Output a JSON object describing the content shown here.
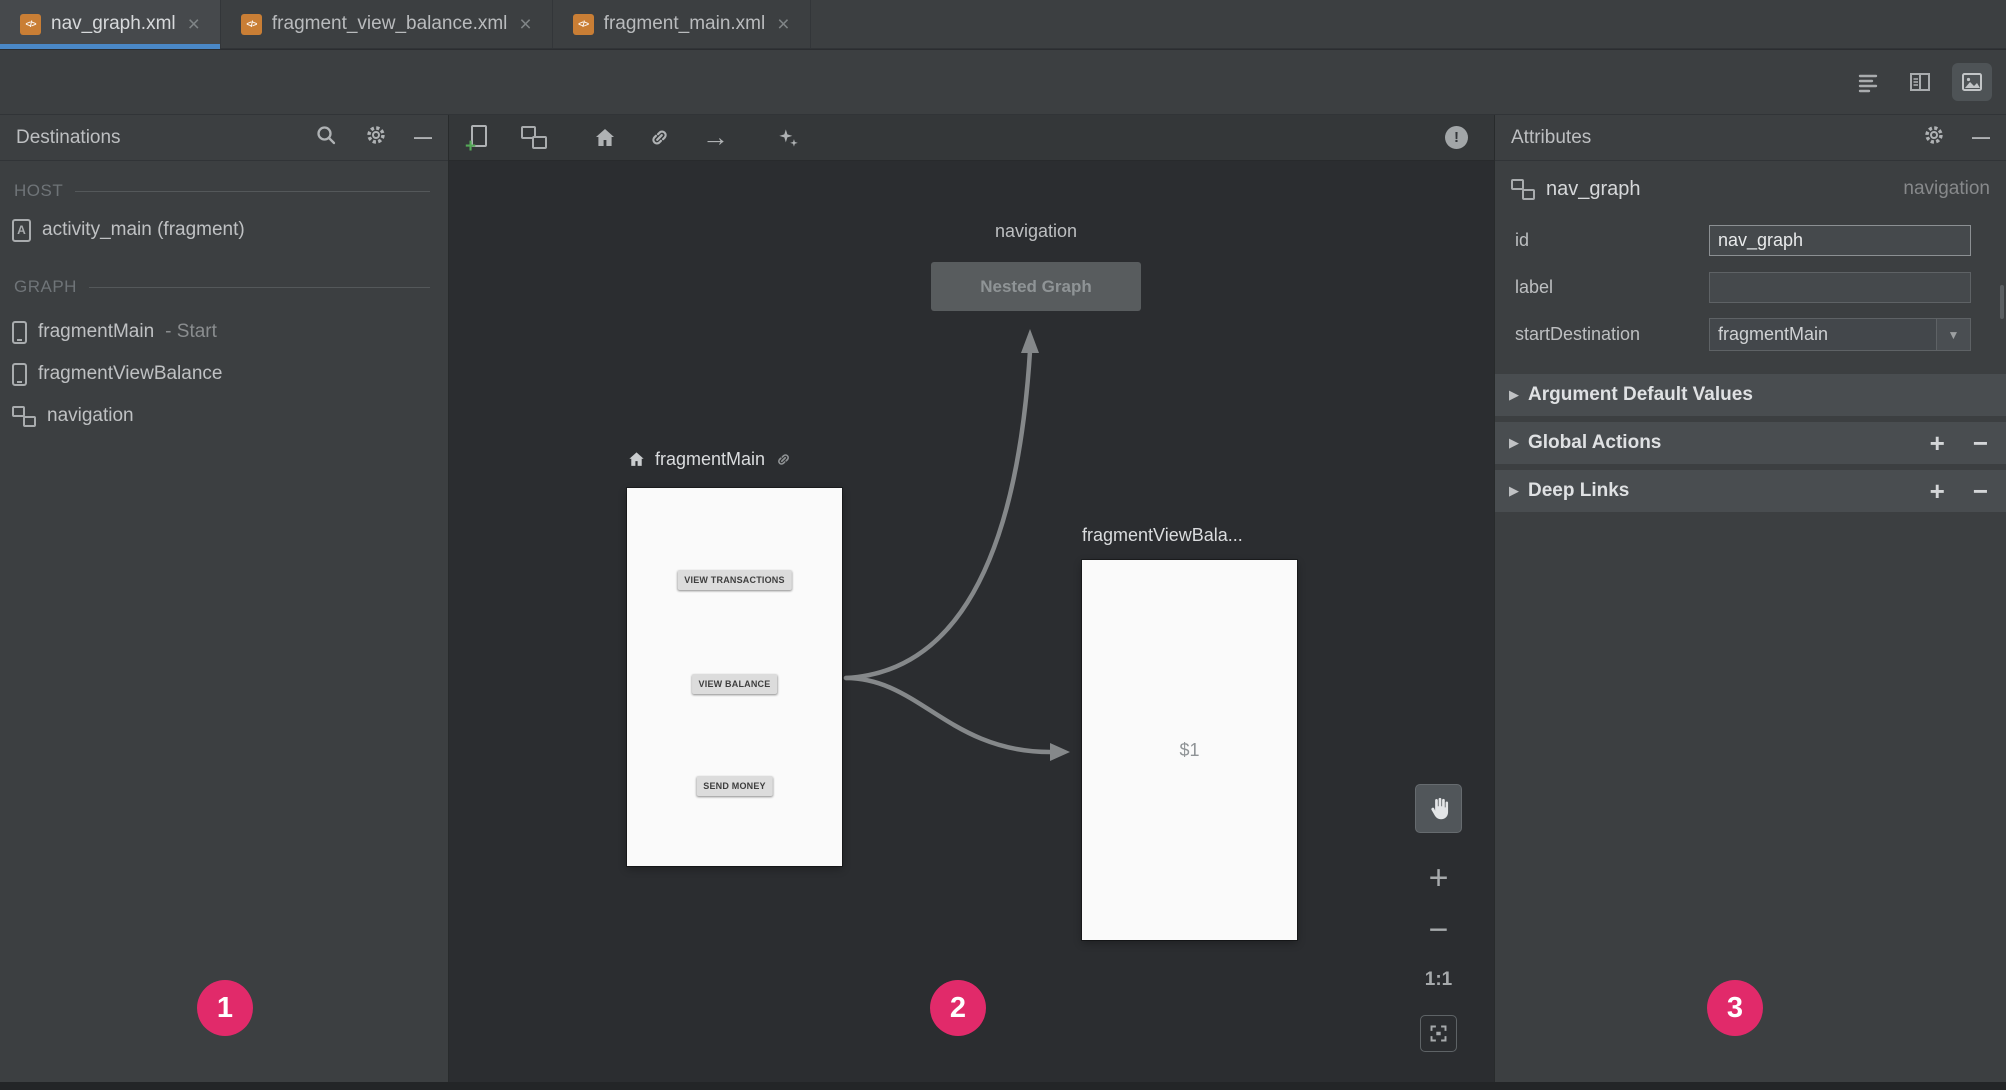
{
  "ui": {
    "close": "×",
    "dash": "—",
    "plus": "+",
    "minus_sign": "−",
    "triangle": "▶",
    "dropdown": "▼",
    "arrow_right": "→",
    "warning": "!",
    "xml_glyph": "</>",
    "activity_letter": "A"
  },
  "colors": {
    "panel_bg": "#3C3F41",
    "canvas_bg": "#2B2D30",
    "tab_underline": "#4A88C7",
    "badge": "#E12A6A",
    "preview_bg": "#FAFAFA"
  },
  "tabs": [
    {
      "label": "nav_graph.xml"
    },
    {
      "label": "fragment_view_balance.xml"
    },
    {
      "label": "fragment_main.xml"
    }
  ],
  "destinations": {
    "title": "Destinations",
    "host_header": "HOST",
    "graph_header": "GRAPH",
    "host_items": [
      {
        "label": "activity_main (fragment)"
      }
    ],
    "graph_items": [
      {
        "label": "fragmentMain",
        "suffix": "- Start"
      },
      {
        "label": "fragmentViewBalance",
        "suffix": ""
      },
      {
        "label": "navigation",
        "suffix": ""
      }
    ]
  },
  "canvas": {
    "nested": {
      "title": "navigation",
      "box_label": "Nested Graph"
    },
    "main": {
      "title": "fragmentMain",
      "buttons": [
        "VIEW TRANSACTIONS",
        "VIEW BALANCE",
        "SEND MONEY"
      ]
    },
    "balance": {
      "title": "fragmentViewBala...",
      "content": "$1"
    },
    "zoom": {
      "label": "1:1"
    }
  },
  "attributes": {
    "title": "Attributes",
    "component": {
      "name": "nav_graph",
      "type": "navigation"
    },
    "fields": {
      "id": {
        "label": "id",
        "value": "nav_graph"
      },
      "label": {
        "label": "label",
        "value": ""
      },
      "startDestination": {
        "label": "startDestination",
        "value": "fragmentMain"
      }
    },
    "sections": [
      {
        "label": "Argument Default Values"
      },
      {
        "label": "Global Actions"
      },
      {
        "label": "Deep Links"
      }
    ]
  },
  "badges": [
    "1",
    "2",
    "3"
  ]
}
